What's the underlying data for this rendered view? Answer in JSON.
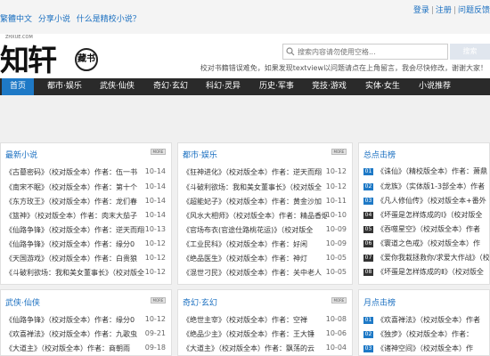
{
  "topbar": {
    "links": [
      "繁體中文",
      "分享小说",
      "什么是精校小说？"
    ],
    "login": "登录",
    "register": "注册",
    "sep": "|",
    "feedback": "问题反馈"
  },
  "header": {
    "logo_small": "ZHXUE.COM",
    "logo_main": "知轩",
    "logo_seal": "藏书",
    "search_placeholder": "搜索内容请勿使用空格...",
    "search_button": "搜索",
    "notice": "校对书籍错误难免，如果发现textview以问题请点在上角留言，我会尽快修改，谢谢大家！"
  },
  "nav": [
    "首页",
    "都市·娱乐",
    "武侠·仙侠",
    "奇幻·玄幻",
    "科幻·灵异",
    "历史·军事",
    "竞技·游戏",
    "实体·女生",
    "小说推荐"
  ],
  "panels": {
    "latest": {
      "title": "最新小说",
      "more": "MORE",
      "rows": [
        {
          "t": "《古墓密码》（校对版全本）作者：伍一书",
          "d": "10-14"
        },
        {
          "t": "《南宋不眠》（校对版全本）作者：第十个",
          "d": "10-14"
        },
        {
          "t": "《东方玫王》（校对版全本）作者：龙们春",
          "d": "10-14"
        },
        {
          "t": "《篮神》（校对版全本）作者：肉末大茄子",
          "d": "10-14"
        },
        {
          "t": "《仙路争锋》（校对版全本）作者：逆天而翔",
          "d": "10-13"
        },
        {
          "t": "《仙路争锋》（校对版全本）作者：缘分0",
          "d": "10-12"
        },
        {
          "t": "《天国游戏》（校对版全本）作者：白贵狼",
          "d": "10-12"
        },
        {
          "t": "《斗破利欲场：我和美女董事长》（校对版全",
          "d": "10-12"
        }
      ]
    },
    "urban": {
      "title": "都市·娱乐",
      "more": "MORE",
      "rows": [
        {
          "t": "《狂神进化》（校对版全本）作者：逆天而翔",
          "d": "10-12"
        },
        {
          "t": "《斗破利欲场：我和美女董事长》（校对版全",
          "d": "10-12"
        },
        {
          "t": "《超能妃子》（校对版全本）作者：黄金沙加",
          "d": "10-11"
        },
        {
          "t": "《风水大相师》（校对版全本）作者：精品香烟",
          "d": "10-10"
        },
        {
          "t": "《官场布衣(官途仕路桃花运)》（校对版全",
          "d": "10-09"
        },
        {
          "t": "《工业民科》（校对版全本）作者：好闲",
          "d": "10-09"
        },
        {
          "t": "《绝品医生》（校对版全本）作者：神灯",
          "d": "10-05"
        },
        {
          "t": "《混世刁民》（校对版全本）作者：关中老人",
          "d": "10-05"
        }
      ]
    },
    "hot": {
      "title": "总点击榜",
      "rows": [
        "《诛仙》（精校版全本）作者：萧鼎",
        "《龙族》（实体版1-3部全本）作者",
        "《凡人修仙传》（校对版全本+番外",
        "《坏蛋是怎样炼成的Ⅰ》（校对版全",
        "《吞噬星空》（校对版全本）作者",
        "《寰道之色戒》（校对版全本）作",
        "《爱你我栽拯救你/求爱大作战》（校",
        "《坏蛋是怎样炼成的Ⅱ》（校对版全"
      ]
    },
    "wuxia": {
      "title": "武侠·仙侠",
      "more": "MORE",
      "rows": [
        {
          "t": "《仙路争锋》（校对版全本）作者：缘分0",
          "d": "10-12"
        },
        {
          "t": "《欢喜禅法》（校对版全本）作者：九歌虫",
          "d": "09-21"
        },
        {
          "t": "《大道主》（校对版全本）作者：商朝雨",
          "d": "09-18"
        }
      ]
    },
    "fantasy": {
      "title": "奇幻·玄幻",
      "more": "MORE",
      "rows": [
        {
          "t": "《绝世主宰》（校对版全本）作者：空禅",
          "d": "10-08"
        },
        {
          "t": "《绝品少主》（校对版全本）作者：王大锤",
          "d": "10-06"
        },
        {
          "t": "《大道主》（校对版全本）作者：飘荡的云",
          "d": "10-04"
        }
      ]
    },
    "month": {
      "title": "月点击榜",
      "rows": [
        "《欢喜禅法》（校对版全本）作者",
        "《独步》（校对版全本）作者：",
        "《诸神空间》（校对版全本）作"
      ]
    }
  },
  "colors": {
    "accent": "#1e79c6",
    "nav_bg": "#2a2a2a"
  }
}
